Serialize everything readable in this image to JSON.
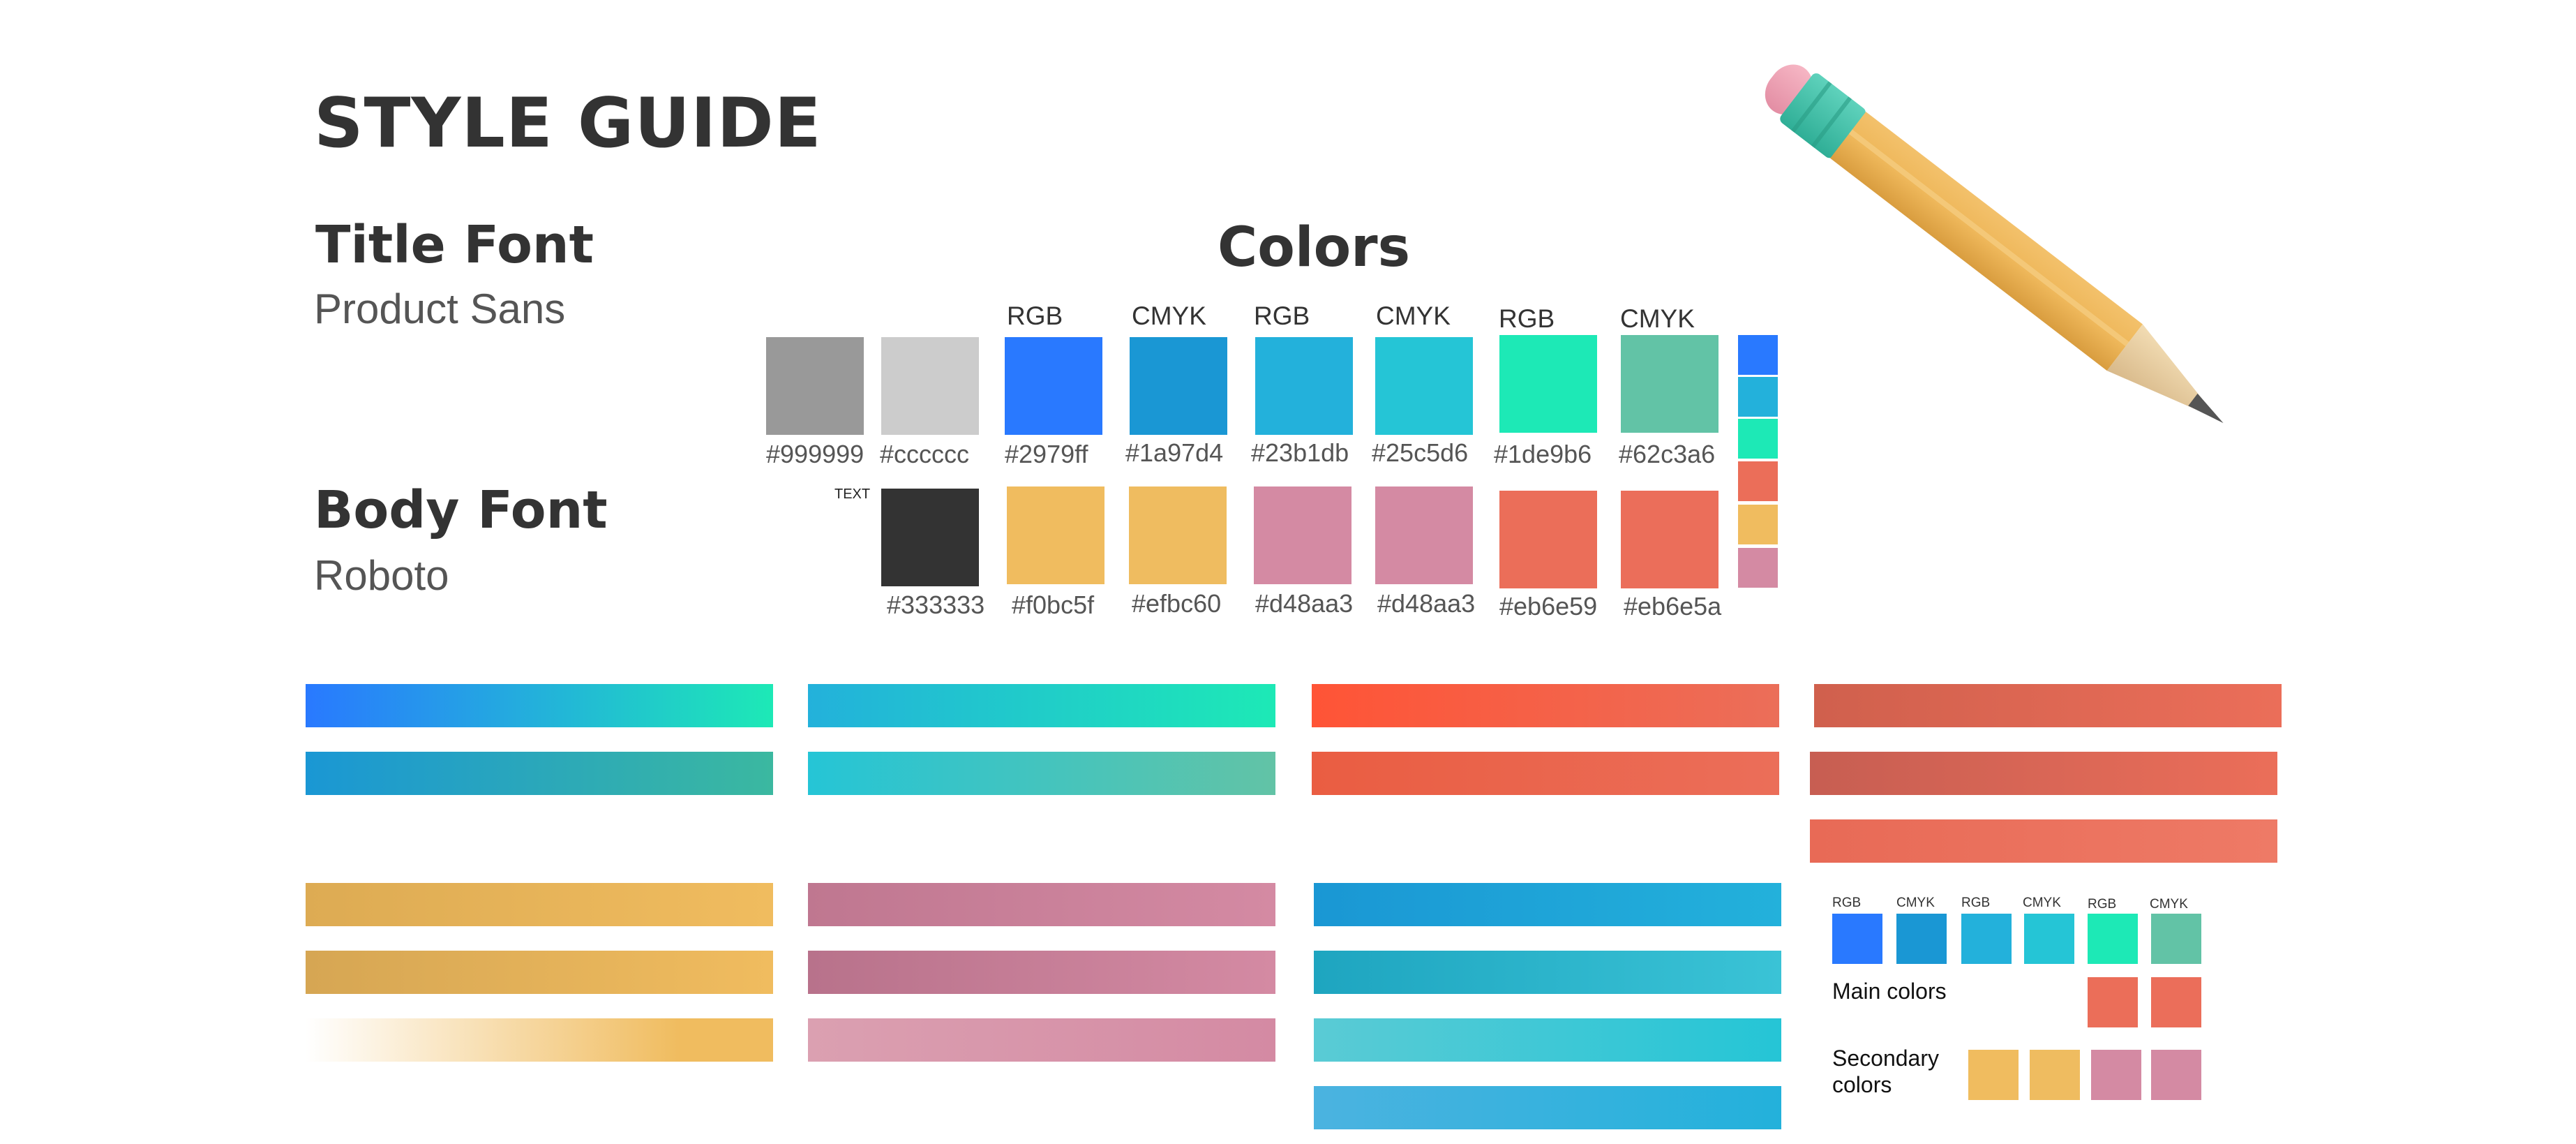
{
  "title": "STYLE GUIDE",
  "fonts": {
    "title_label": "Title Font",
    "title_value": "Product Sans",
    "body_label": "Body Font",
    "body_value": "Roboto"
  },
  "colors_heading": "Colors",
  "palette_headers": [
    "RGB",
    "CMYK",
    "RGB",
    "CMYK",
    "RGB",
    "CMYK"
  ],
  "row1": [
    {
      "hex": "#999999",
      "color": "#999999"
    },
    {
      "hex": "#cccccc",
      "color": "#cccccc"
    },
    {
      "hex": "#2979ff",
      "color": "#2979ff"
    },
    {
      "hex": "#1a97d4",
      "color": "#1a97d4"
    },
    {
      "hex": "#23b1db",
      "color": "#23b1db"
    },
    {
      "hex": "#25c5d6",
      "color": "#25c5d6"
    },
    {
      "hex": "#1de9b6",
      "color": "#1de9b6"
    },
    {
      "hex": "#62c3a6",
      "color": "#62c3a6"
    }
  ],
  "text_label": "TEXT",
  "row2": [
    {
      "hex": "#333333",
      "color": "#333333"
    },
    {
      "hex": "#f0bc5f",
      "color": "#f0bc5f"
    },
    {
      "hex": "#efbc60",
      "color": "#efbc60"
    },
    {
      "hex": "#d48aa3",
      "color": "#d48aa3"
    },
    {
      "hex": "#d48aa3",
      "color": "#d48aa3"
    },
    {
      "hex": "#eb6e59",
      "color": "#eb6e59"
    },
    {
      "hex": "#eb6e5a",
      "color": "#eb6e5a"
    }
  ],
  "strip_colors": [
    "#2979ff",
    "#23b1db",
    "#1de9b6",
    "#eb6e59",
    "#f0bc5f",
    "#d48aa3"
  ],
  "legend": {
    "headers": [
      "RGB",
      "CMYK",
      "RGB",
      "CMYK",
      "RGB",
      "CMYK"
    ],
    "main_label": "Main colors",
    "secondary_label": "Secondary colors",
    "main_colors": [
      "#2979ff",
      "#1a97d4",
      "#23b1db",
      "#25c5d6",
      "#1de9b6",
      "#62c3a6"
    ],
    "accent_colors": [
      "#eb6e59",
      "#eb6e5a"
    ],
    "secondary_colors": [
      "#f0bc5f",
      "#efbc60",
      "#d48aa3",
      "#d48aa3"
    ]
  }
}
